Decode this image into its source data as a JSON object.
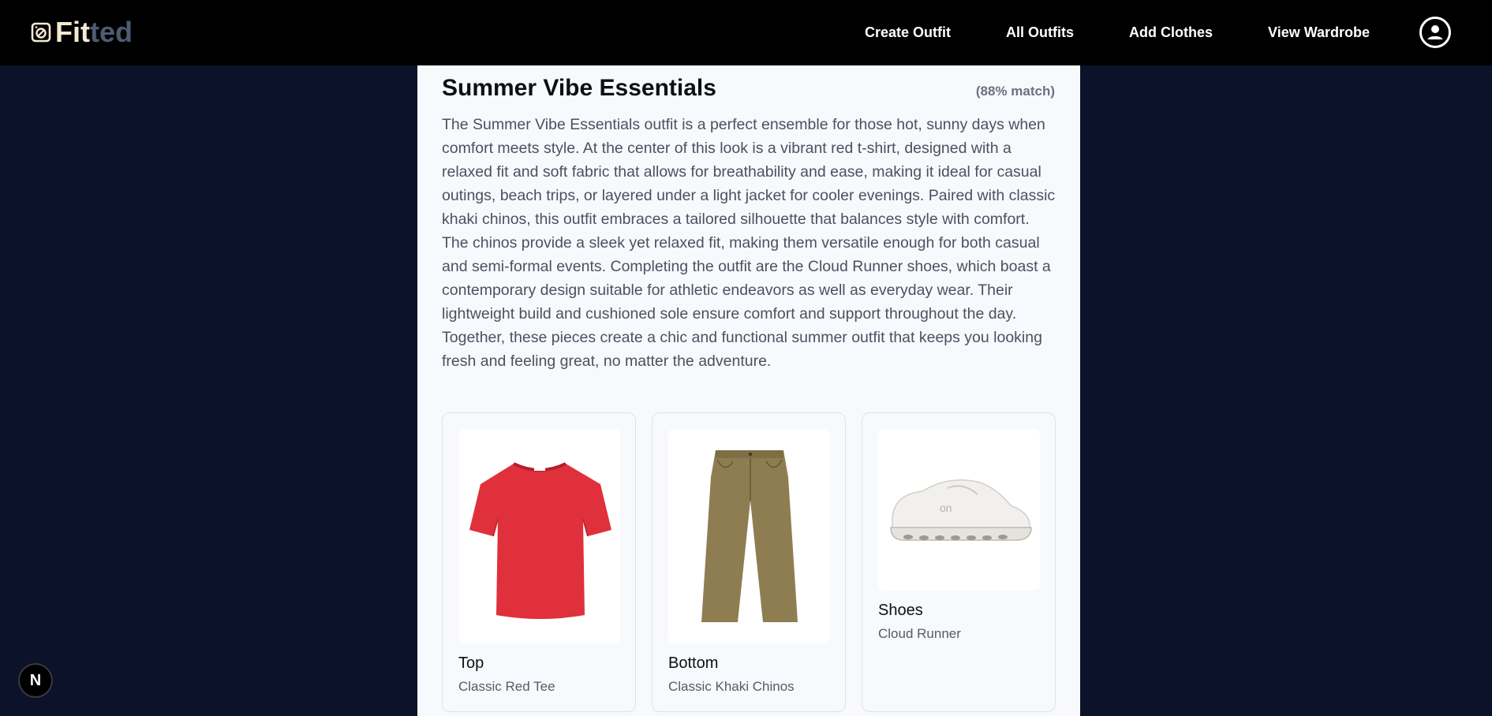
{
  "brand": {
    "part1": "Fit",
    "part2": "ted",
    "icon": "hanger-logo-icon"
  },
  "nav": {
    "links": [
      "Create Outfit",
      "All Outfits",
      "Add Clothes",
      "View Wardrobe"
    ],
    "profile_icon": "user-circle-icon"
  },
  "outfit": {
    "title": "Summer Vibe Essentials",
    "match": "(88% match)",
    "description": "The Summer Vibe Essentials outfit is a perfect ensemble for those hot, sunny days when comfort meets style. At the center of this look is a vibrant red t-shirt, designed with a relaxed fit and soft fabric that allows for breathability and ease, making it ideal for casual outings, beach trips, or layered under a light jacket for cooler evenings. Paired with classic khaki chinos, this outfit embraces a tailored silhouette that balances style with comfort. The chinos provide a sleek yet relaxed fit, making them versatile enough for both casual and semi-formal events. Completing the outfit are the Cloud Runner shoes, which boast a contemporary design suitable for athletic endeavors as well as everyday wear. Their lightweight build and cushioned sole ensure comfort and support throughout the day. Together, these pieces create a chic and functional summer outfit that keeps you looking fresh and feeling great, no matter the adventure.",
    "items": [
      {
        "category": "Top",
        "name": "Classic Red Tee"
      },
      {
        "category": "Bottom",
        "name": "Classic Khaki Chinos"
      },
      {
        "category": "Shoes",
        "name": "Cloud Runner"
      }
    ]
  },
  "dev_badge": "N",
  "colors": {
    "background": "#0b1229",
    "navbar": "#000000",
    "panel": "#f7f9fc",
    "brand_light": "#f3ead3",
    "brand_dark": "#4c5d72",
    "tee_red": "#e0303c",
    "chino_khaki": "#8f7d52"
  }
}
